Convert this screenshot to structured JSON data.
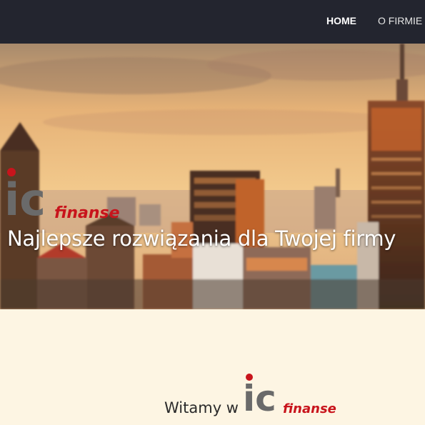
{
  "nav": {
    "items": [
      {
        "label": "HOME",
        "active": true
      },
      {
        "label": "O FIRMIE",
        "active": false
      }
    ]
  },
  "hero": {
    "logo": {
      "ic": "ic",
      "finanse": "finanse"
    },
    "tagline": "Najlepsze rozwiązania dla Twojej firmy"
  },
  "welcome": {
    "text": "Witamy w",
    "logo": {
      "ic": "ic",
      "finanse": "finanse"
    }
  },
  "colors": {
    "navbar": "#23252f",
    "page_background": "#fdf5e3",
    "logo_gray": "#6a6a6a",
    "logo_red": "#c8141c"
  }
}
